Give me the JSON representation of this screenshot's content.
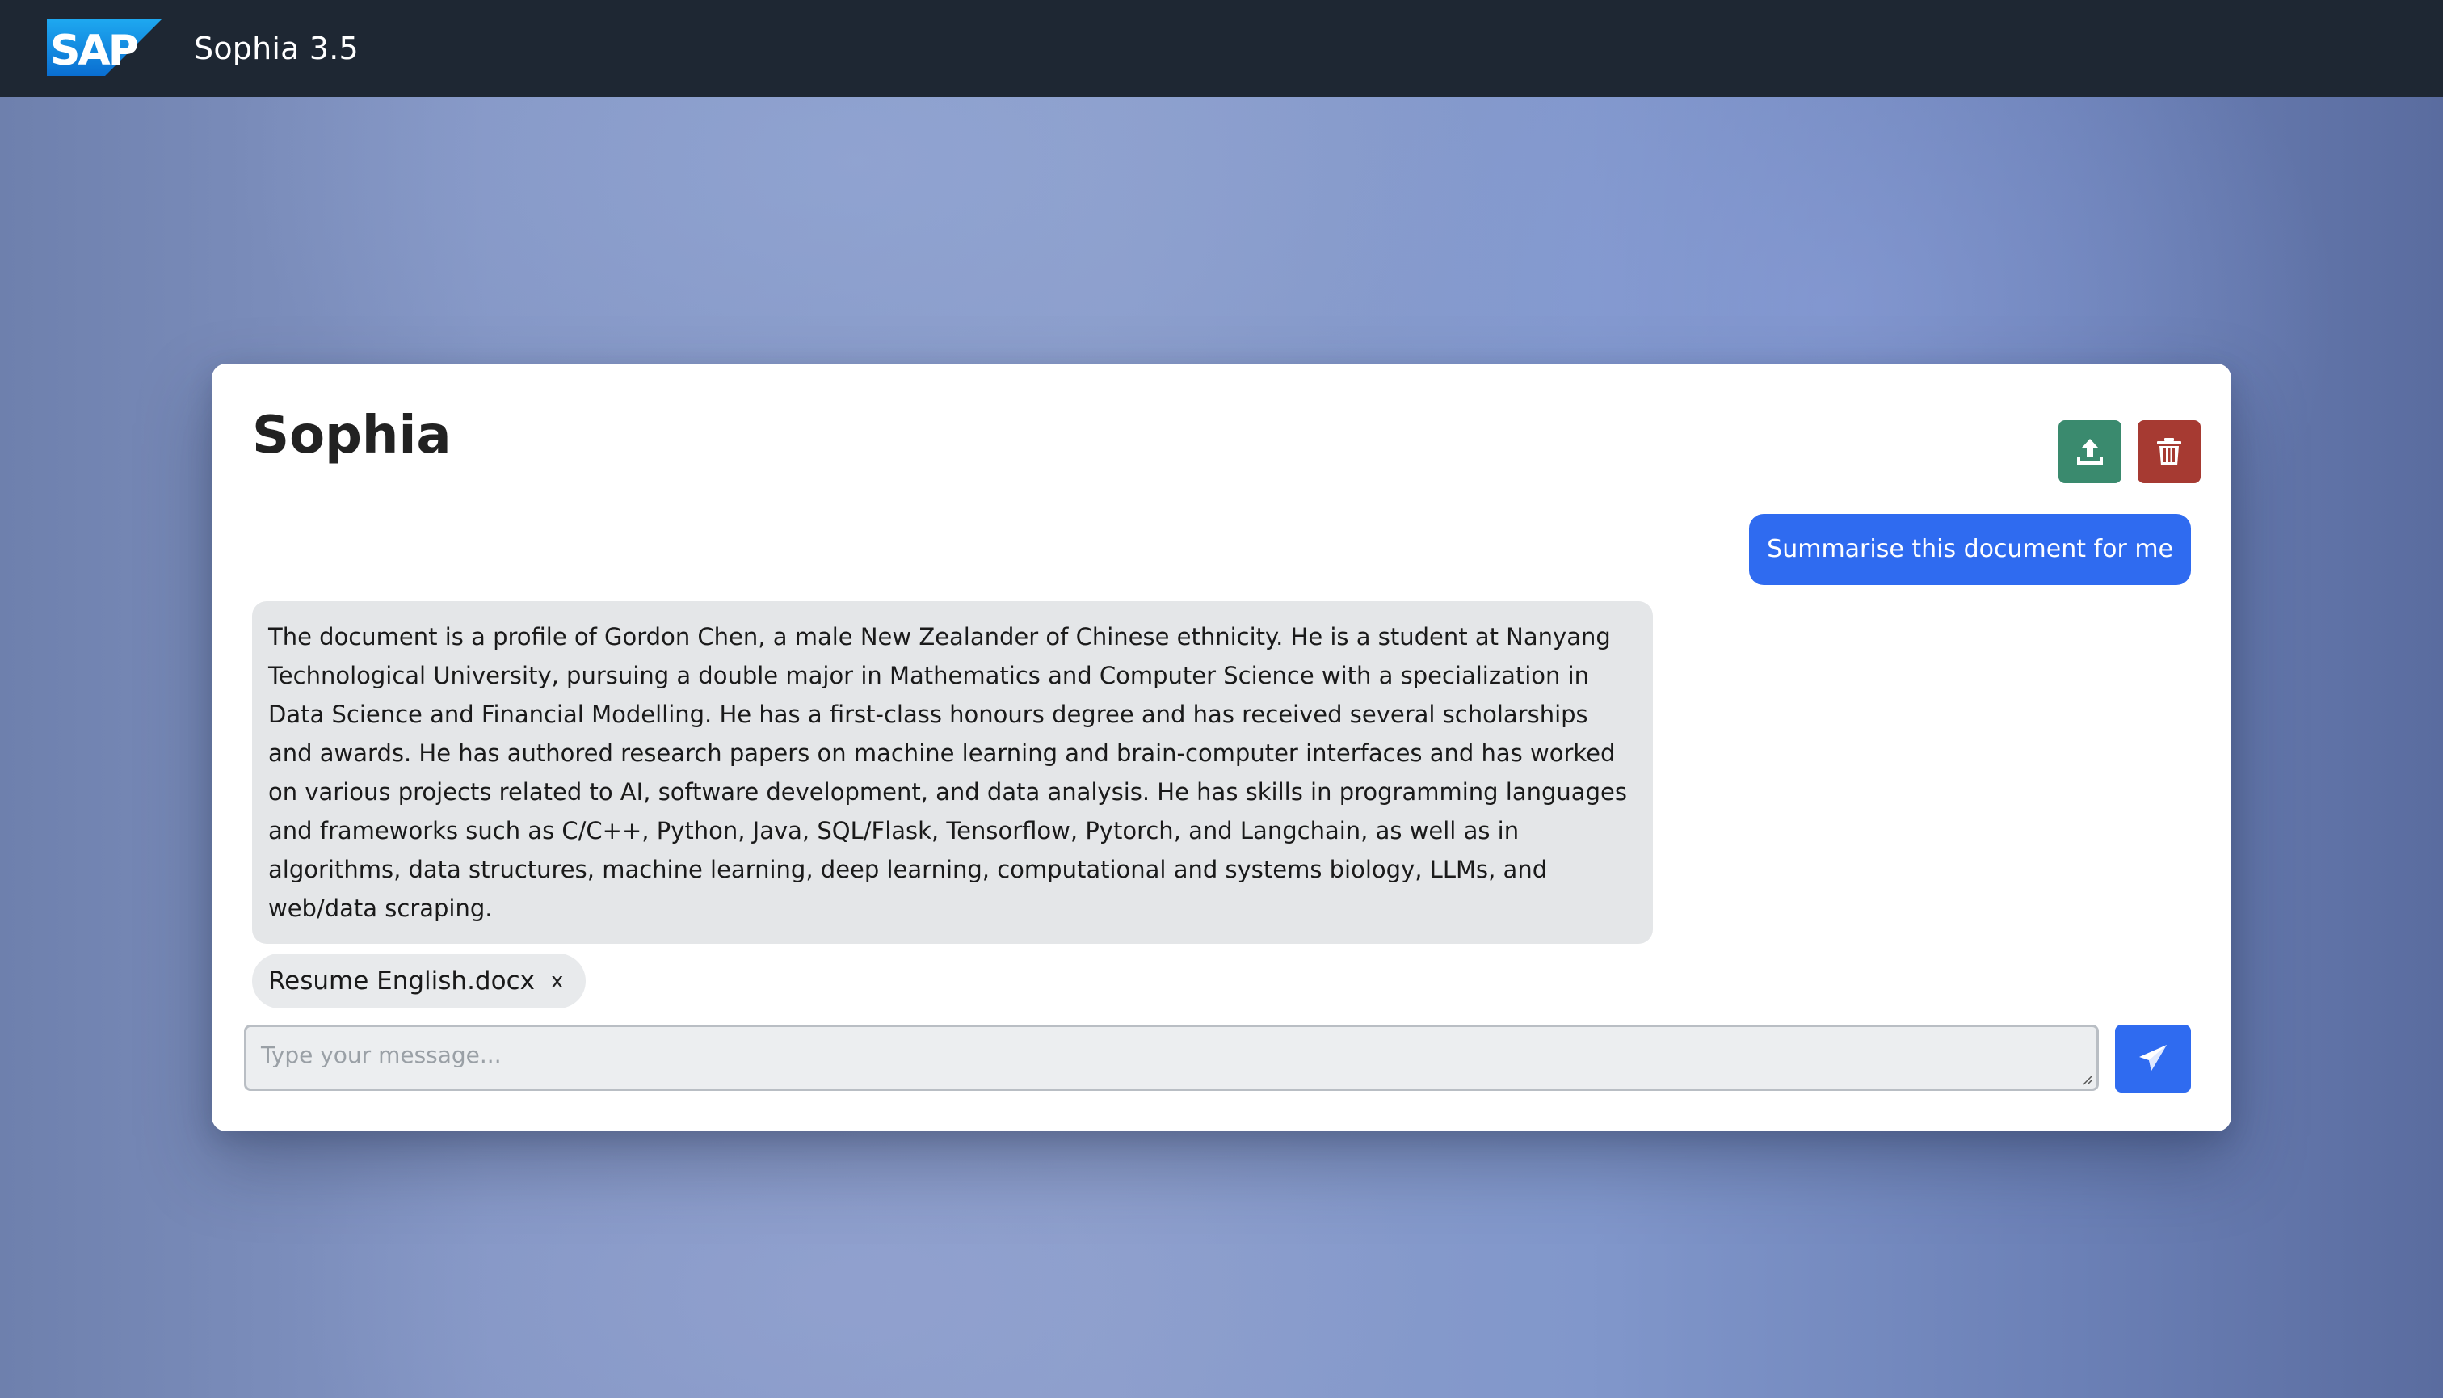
{
  "header": {
    "logo_text": "SAP",
    "app_title": "Sophia 3.5"
  },
  "chat": {
    "title": "Sophia",
    "toolbar": {
      "upload_icon": "upload-icon",
      "delete_icon": "trash-icon",
      "upload_color": "#3a8a6e",
      "delete_color": "#a63a32"
    },
    "messages": [
      {
        "role": "user",
        "text": "Summarise this document for me"
      },
      {
        "role": "assistant",
        "text": "The document is a profile of Gordon Chen, a male New Zealander of Chinese ethnicity. He is a student at Nanyang Technological University, pursuing a double major in Mathematics and Computer Science with a specialization in Data Science and Financial Modelling. He has a first-class honours degree and has received several scholarships and awards. He has authored research papers on machine learning and brain-computer interfaces and has worked on various projects related to AI, software development, and data analysis. He has skills in programming languages and frameworks such as C/C++, Python, Java, SQL/Flask, Tensorflow, Pytorch, and Langchain, as well as in algorithms, data structures, machine learning, deep learning, computational and systems biology, LLMs, and web/data scraping."
      }
    ],
    "attachment": {
      "filename": "Resume English.docx",
      "remove_label": "x"
    },
    "input": {
      "placeholder": "Type your message...",
      "value": ""
    },
    "send_icon": "paper-plane-icon",
    "accent_color": "#2f6bf0"
  }
}
